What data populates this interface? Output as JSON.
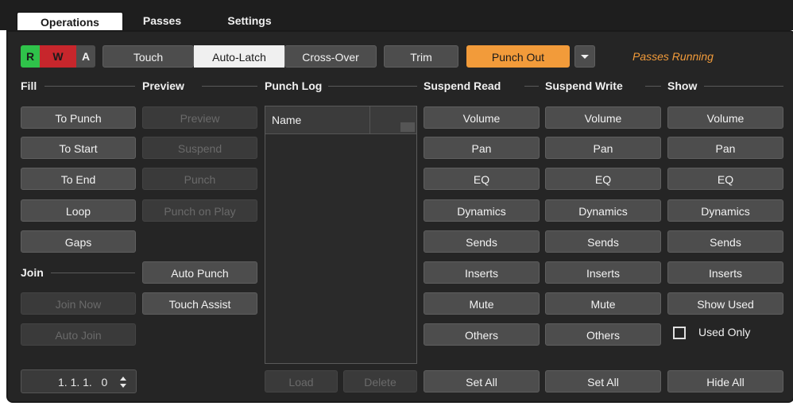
{
  "tabs": {
    "operations": "Operations",
    "passes": "Passes",
    "settings": "Settings"
  },
  "rwa": {
    "r": "R",
    "w": "W",
    "a": "A"
  },
  "modes": {
    "touch": "Touch",
    "auto_latch": "Auto-Latch",
    "cross_over": "Cross-Over",
    "trim": "Trim",
    "punch_out": "Punch Out"
  },
  "status": "Passes Running",
  "fill": {
    "header": "Fill",
    "to_punch": "To Punch",
    "to_start": "To Start",
    "to_end": "To End",
    "loop": "Loop",
    "gaps": "Gaps"
  },
  "join": {
    "header": "Join",
    "join_now": "Join Now",
    "auto_join": "Auto Join"
  },
  "position": "1. 1. 1.   0",
  "preview": {
    "header": "Preview",
    "preview": "Preview",
    "suspend": "Suspend",
    "punch": "Punch",
    "punch_on_play": "Punch on Play",
    "auto_punch": "Auto Punch",
    "touch_assist": "Touch Assist"
  },
  "punch_log": {
    "header": "Punch Log",
    "col_name": "Name",
    "load": "Load",
    "delete": "Delete"
  },
  "suspend_read": {
    "header": "Suspend Read",
    "volume": "Volume",
    "pan": "Pan",
    "eq": "EQ",
    "dynamics": "Dynamics",
    "sends": "Sends",
    "inserts": "Inserts",
    "mute": "Mute",
    "others": "Others",
    "set_all": "Set All"
  },
  "suspend_write": {
    "header": "Suspend Write",
    "volume": "Volume",
    "pan": "Pan",
    "eq": "EQ",
    "dynamics": "Dynamics",
    "sends": "Sends",
    "inserts": "Inserts",
    "mute": "Mute",
    "others": "Others",
    "set_all": "Set All"
  },
  "show": {
    "header": "Show",
    "volume": "Volume",
    "pan": "Pan",
    "eq": "EQ",
    "dynamics": "Dynamics",
    "sends": "Sends",
    "inserts": "Inserts",
    "show_used": "Show Used",
    "used_only": "Used Only",
    "hide_all": "Hide All"
  },
  "colors": {
    "read": "#2fc24a",
    "write": "#c7262c",
    "accent": "#f29b3a",
    "panel": "#252525"
  }
}
